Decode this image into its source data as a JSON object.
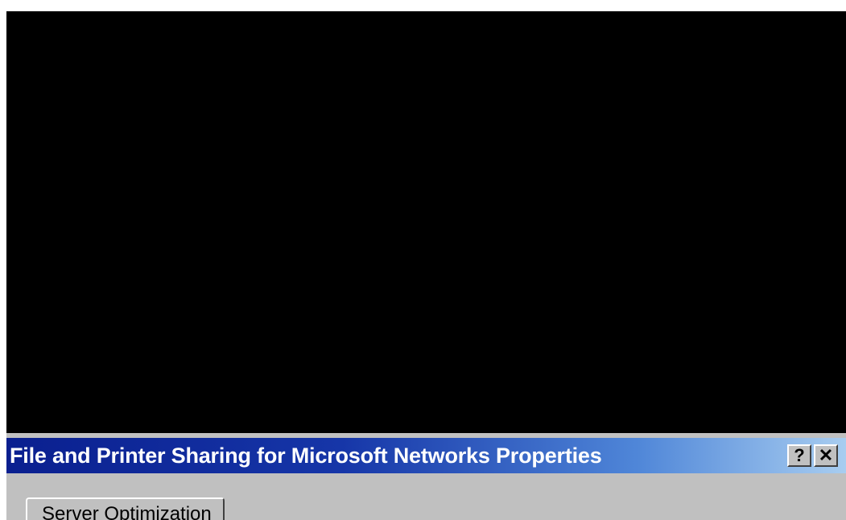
{
  "dialog": {
    "title": "File and Printer Sharing for Microsoft Networks Properties",
    "help_button_label": "?",
    "close_button_label": "✕",
    "tabs": [
      {
        "label": "Server Optimization"
      }
    ]
  },
  "colors": {
    "titlebar_start": "#0a1f8f",
    "titlebar_end": "#a8cdf0",
    "dialog_face": "#c0c0c0",
    "background": "#000000"
  },
  "icons": [
    "help-icon",
    "close-icon"
  ]
}
